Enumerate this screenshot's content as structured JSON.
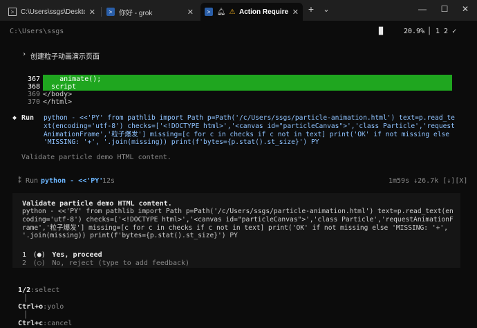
{
  "titlebar": {
    "tabs": [
      {
        "label": "C:\\Users\\ssgs\\Desktop\\CLIProx",
        "icon": "terminal-icon"
      },
      {
        "label": "你好 - grok",
        "icon": "powershell-icon"
      },
      {
        "label": "Action Required · ‑ ‑ ",
        "icon": "powershell-icon",
        "bell": "bell-icon",
        "warn": "warning-icon"
      }
    ],
    "new_tab": "+",
    "dropdown": "⌄",
    "minimize": "—",
    "maximize": "☐",
    "close": "✕",
    "tab_close": "✕"
  },
  "status": {
    "cwd": "C:\\Users\\ssgs",
    "cursor": "█",
    "percent": "20.9%",
    "pipe": "│",
    "counter": "1 2 ✓"
  },
  "prompt": {
    "chevron": "›",
    "text": "创建粒子动画演示页面"
  },
  "code": {
    "lines": [
      {
        "num": "367",
        "text": "    animate();"
      },
      {
        "num": "368",
        "text": "  script"
      },
      {
        "num": "369",
        "text": "</body>"
      },
      {
        "num": "370",
        "text": "</html>"
      }
    ]
  },
  "run1": {
    "bullet": "◆",
    "label": "Run",
    "cmd": "python - <<'PY' from pathlib import Path p=Path('/c/Users/ssgs/particle-animation.html') text=p.read_text(encoding='utf-8') checks=['<!DOCTYPE html>','<canvas id=\"particleCanvas\">','class Particle','requestAnimationFrame','粒子爆发'] missing=[c for c in checks if c not in text] print('OK' if not missing else 'MISSING: '+', '.join(missing)) print(f'bytes={p.stat().st_size}') PY",
    "desc": "Validate particle demo HTML content."
  },
  "run2": {
    "bullet": "⁑",
    "label": "Run",
    "cmd": "python - <<'PY'",
    "elapsed": "12s",
    "right": "1m59s ↓26.7k [↓][X]"
  },
  "approval": {
    "title": "Validate particle demo HTML content.",
    "cmd": "python - <<'PY' from pathlib import Path p=Path('/c/Users/ssgs/particle-animation.html') text=p.read_text(encoding='utf-8') checks=['<!DOCTYPE html>','<canvas id=\"particleCanvas\">','class Particle','requestAnimationFrame','粒子爆发'] missing=[c for c in checks if c not in text] print('OK' if not missing else 'MISSING: '+', '.join(missing)) print(f'bytes={p.stat().st_size}') PY",
    "options": [
      {
        "num": "1",
        "radio": "(●)",
        "label": "Yes, proceed"
      },
      {
        "num": "2",
        "radio": "(○)",
        "label": "No, reject (type to add feedback)"
      }
    ]
  },
  "footer": {
    "k1": "1/2",
    "a1": ":select",
    "k2": "Ctrl+o",
    "a2": ":yolo",
    "k3": "Ctrl+c",
    "a3": ":cancel",
    "sep": "│"
  },
  "colors": {
    "highlight": "#1fa61f",
    "command": "#6cb6ff",
    "background": "#0c0c0c"
  }
}
